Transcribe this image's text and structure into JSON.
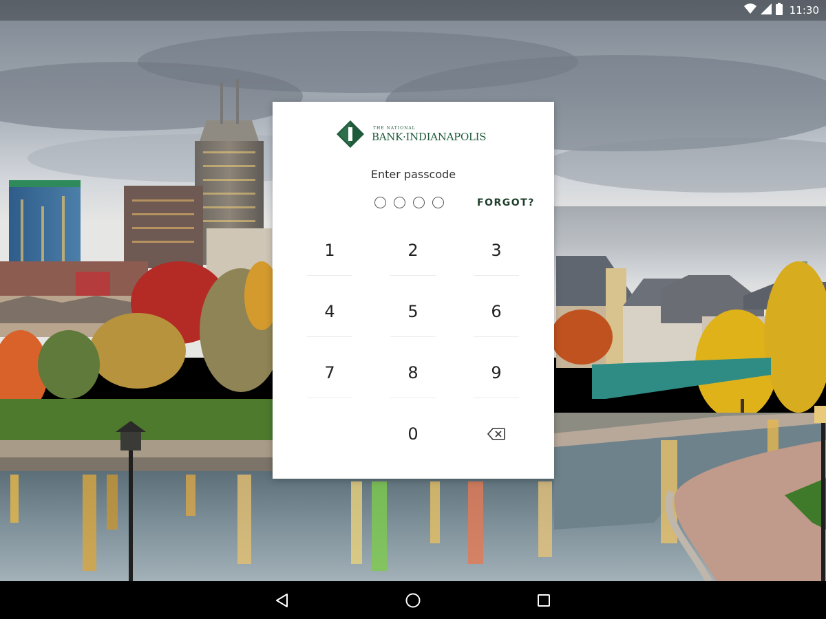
{
  "status_bar": {
    "time": "11:30",
    "icons": [
      "wifi-icon",
      "cell-signal-icon",
      "battery-icon"
    ]
  },
  "card": {
    "logo": {
      "small_text": "THE NATIONAL",
      "big_text": "BANK·INDIANAPOLIS",
      "mark_letter": "I",
      "color": "#1f5a3a"
    },
    "prompt": "Enter passcode",
    "passcode_length": 4,
    "forgot_label": "FORGOT?",
    "keys": [
      "1",
      "2",
      "3",
      "4",
      "5",
      "6",
      "7",
      "8",
      "9",
      "0"
    ],
    "delete_icon": "backspace-icon"
  },
  "nav_bar": {
    "buttons": [
      "back-icon",
      "home-icon",
      "recents-icon"
    ]
  }
}
